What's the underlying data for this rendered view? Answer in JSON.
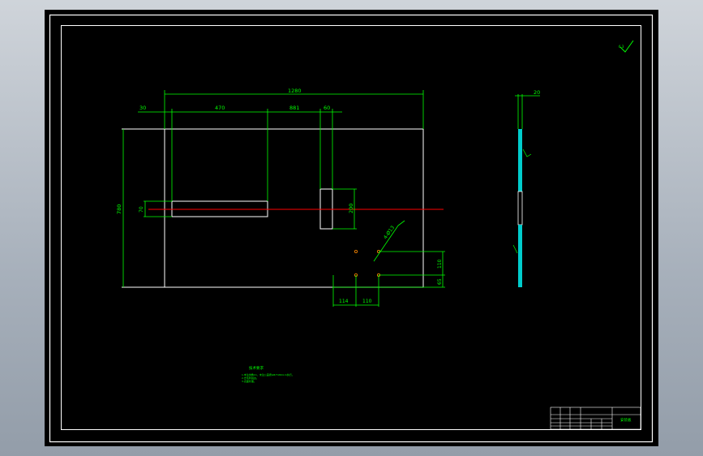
{
  "dimensions": {
    "overall_width": "1280",
    "left_offset": "30",
    "slot_width": "470",
    "window_position": "881",
    "window_width": "60",
    "overall_height": "780",
    "slot_height": "70",
    "window_height": "200",
    "hole_spacing_x1": "114",
    "hole_spacing_x2": "110",
    "hole_spacing_y1": "110",
    "hole_spacing_y2": "65",
    "hole_callout": "4-Ø13",
    "side_thickness": "20"
  },
  "tech_notes": {
    "title": "技术要求",
    "line1": "1.未注倒角C1，未注公差按GB/T1804-m执行。",
    "line2": "2.去毛刺锐边。",
    "line3": "3.表面处理。"
  },
  "title_block": {
    "part_name": "安装板"
  },
  "colors": {
    "background": "#000000",
    "outline": "#ffffff",
    "dimension": "#00ff00",
    "centerline": "#ff0000",
    "hatch": "#00ffff",
    "app_frame": "#a7b0bb"
  }
}
